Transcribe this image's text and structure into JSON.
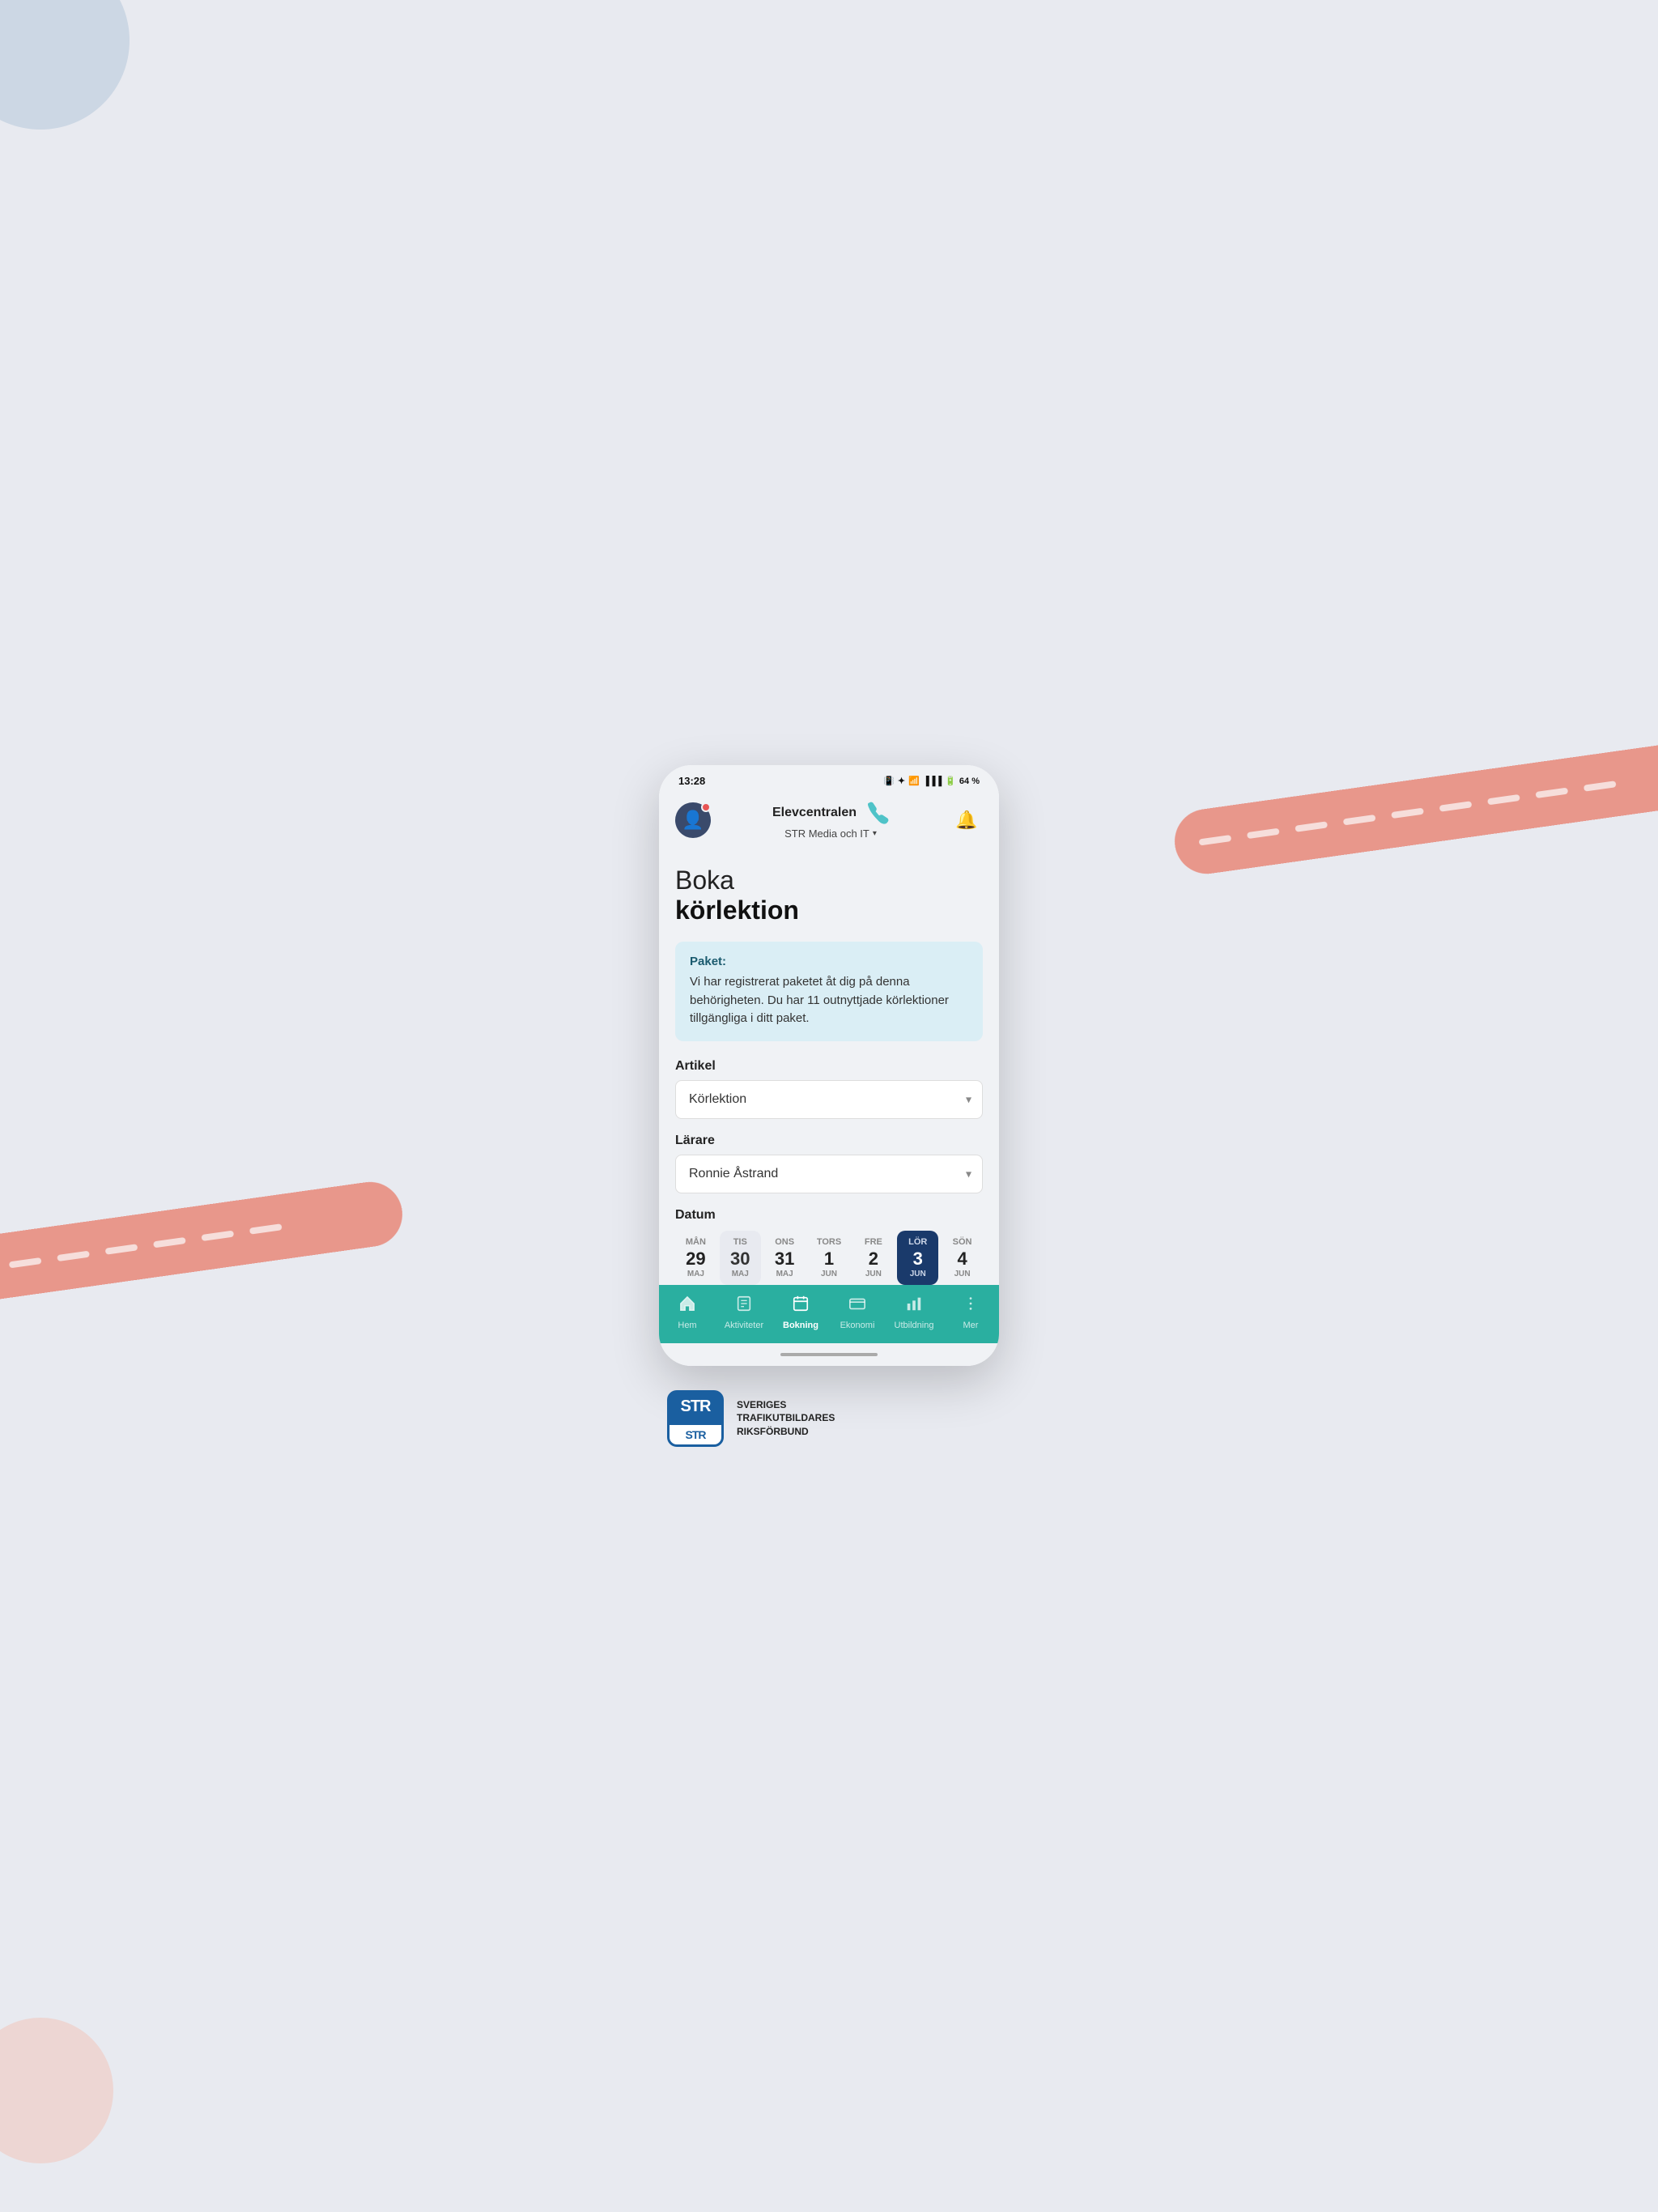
{
  "statusBar": {
    "time": "13:28",
    "batteryPercent": "64 %"
  },
  "header": {
    "appName": "Elevcentralen",
    "subtitle": "STR Media och IT",
    "bellIcon": "🔔"
  },
  "page": {
    "titleLine1": "Boka",
    "titleLine2": "körlektion"
  },
  "infoBox": {
    "label": "Paket:",
    "text": "Vi har registrerat paketet åt dig på denna behörigheten. Du har 11 outnyttjade körlektioner tillgängliga i ditt paket."
  },
  "artikelLabel": "Artikel",
  "artikelValue": "Körlektion",
  "larareLabel": "Lärare",
  "larareValue": "Ronnie Åstrand",
  "datumLabel": "Datum",
  "calendar": {
    "days": [
      {
        "dayName": "MÅN",
        "number": "29",
        "month": "MAJ",
        "active": false,
        "highlighted": false
      },
      {
        "dayName": "TIS",
        "number": "30",
        "month": "MAJ",
        "active": false,
        "highlighted": true
      },
      {
        "dayName": "ONS",
        "number": "31",
        "month": "MAJ",
        "active": false,
        "highlighted": false
      },
      {
        "dayName": "TORS",
        "number": "1",
        "month": "JUN",
        "active": false,
        "highlighted": false
      },
      {
        "dayName": "FRE",
        "number": "2",
        "month": "JUN",
        "active": false,
        "highlighted": false
      },
      {
        "dayName": "LÖR",
        "number": "3",
        "month": "JUN",
        "active": true,
        "highlighted": false
      },
      {
        "dayName": "SÖN",
        "number": "4",
        "month": "JUN",
        "active": false,
        "highlighted": false
      }
    ]
  },
  "bottomNav": {
    "items": [
      {
        "label": "Hem",
        "icon": "⌂",
        "active": false
      },
      {
        "label": "Aktiviteter",
        "icon": "📋",
        "active": false
      },
      {
        "label": "Bokning",
        "icon": "📅",
        "active": true
      },
      {
        "label": "Ekonomi",
        "icon": "💳",
        "active": false
      },
      {
        "label": "Utbildning",
        "icon": "📊",
        "active": false
      },
      {
        "label": "Mer",
        "icon": "⋮",
        "active": false
      }
    ]
  },
  "strLogo": {
    "text": "STR",
    "orgName": "SVERIGES\nTRAFIKUTBILDARES\nRIKSFÖRBUND"
  }
}
